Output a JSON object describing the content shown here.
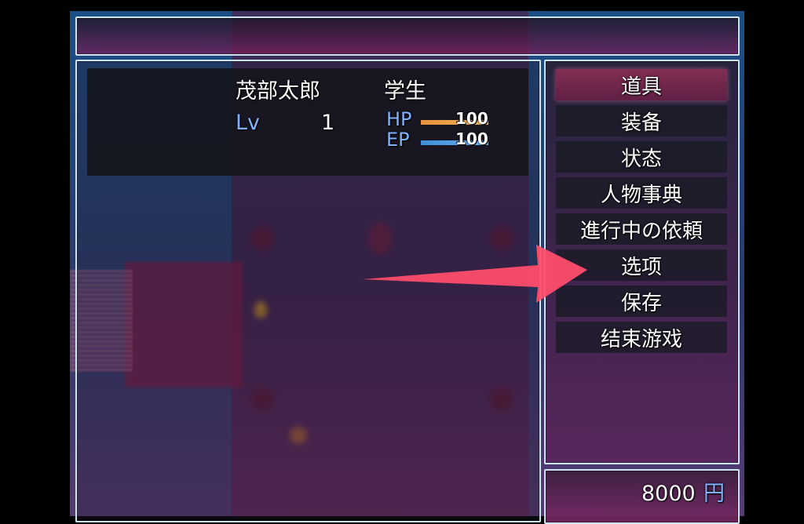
{
  "actor": {
    "name": "茂部太郎",
    "class": "学生",
    "level_label": "Lv",
    "level": "1",
    "hp_label": "HP",
    "hp": "100",
    "hp_fraction": 1.0,
    "ep_label": "EP",
    "ep": "100",
    "ep_fraction": 1.0
  },
  "menu": {
    "items": [
      {
        "label": "道具"
      },
      {
        "label": "装备"
      },
      {
        "label": "状态"
      },
      {
        "label": "人物事典"
      },
      {
        "label": "進行中の依頼"
      },
      {
        "label": "选项"
      },
      {
        "label": "保存"
      },
      {
        "label": "结束游戏"
      }
    ],
    "selected_index": 0
  },
  "gold": {
    "amount": "8000",
    "unit": "円"
  },
  "colors": {
    "hp_gauge": "#e8923a",
    "ep_gauge": "#3f8fd8",
    "system_text": "#7fb1ff",
    "window_border": "#cfe3ee",
    "arrow": "#ff4d6d"
  }
}
